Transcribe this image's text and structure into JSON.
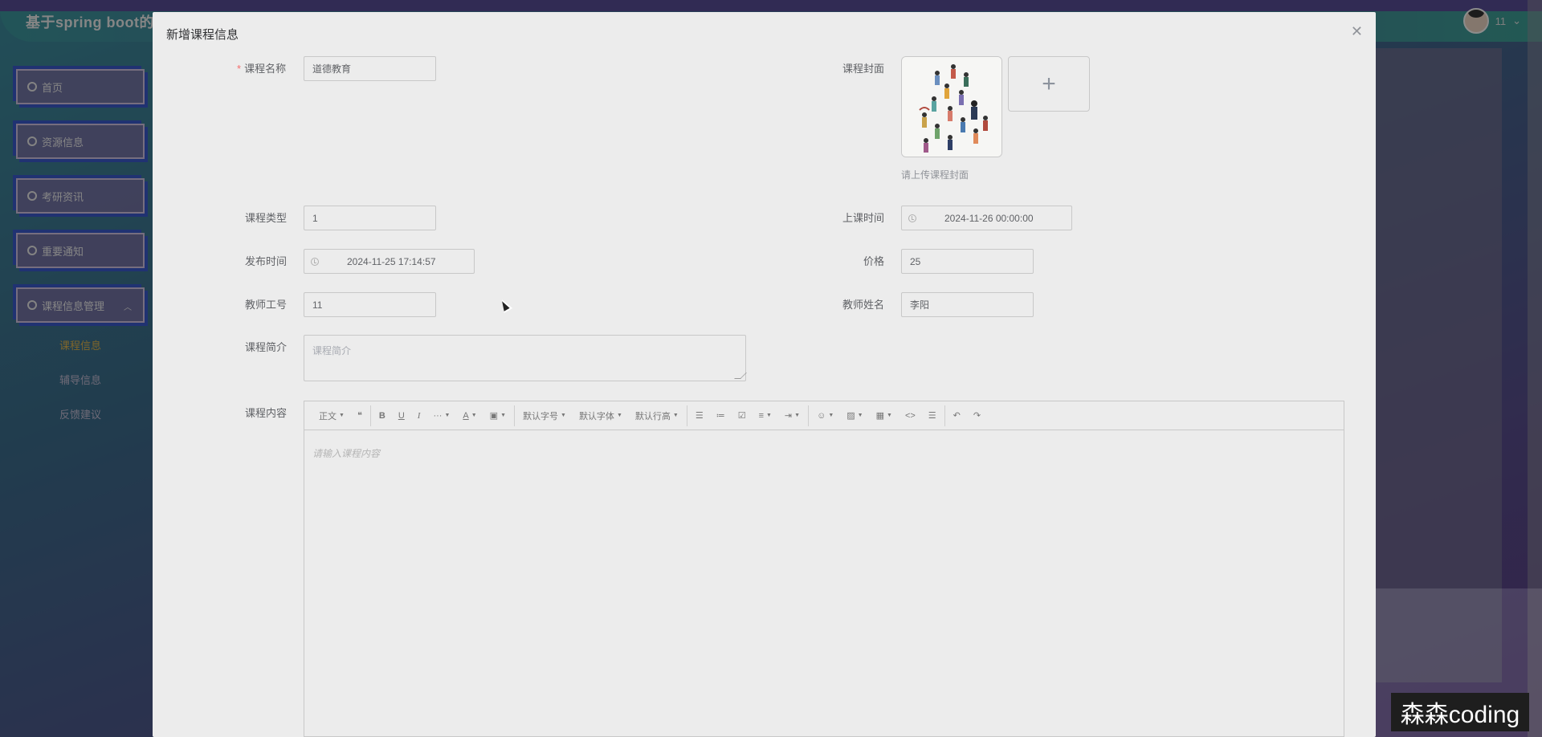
{
  "app": {
    "title": "基于spring boot的",
    "user_name": "11"
  },
  "sidebar": {
    "items": [
      {
        "label": "首页",
        "icon": "home-icon"
      },
      {
        "label": "资源信息",
        "icon": "grid-icon"
      },
      {
        "label": "考研资讯",
        "icon": "circle-icon"
      },
      {
        "label": "重要通知",
        "icon": "doc-icon"
      },
      {
        "label": "课程信息管理",
        "icon": "grid-icon"
      }
    ],
    "submenu": [
      {
        "label": "课程信息",
        "active": true
      },
      {
        "label": "辅导信息",
        "active": false
      },
      {
        "label": "反馈建议",
        "active": false
      }
    ]
  },
  "dialog": {
    "title": "新增课程信息",
    "close_icon": "close-icon",
    "fields": {
      "course_name": {
        "label": "课程名称",
        "value": "道德教育",
        "required": true
      },
      "cover": {
        "label": "课程封面",
        "hint": "请上传课程封面"
      },
      "course_type": {
        "label": "课程类型",
        "value": "1"
      },
      "class_time": {
        "label": "上课时间",
        "value": "2024-11-26 00:00:00"
      },
      "publish_time": {
        "label": "发布时间",
        "value": "2024-11-25 17:14:57"
      },
      "price": {
        "label": "价格",
        "value": "25"
      },
      "teacher_id": {
        "label": "教师工号",
        "value": "11"
      },
      "teacher_name": {
        "label": "教师姓名",
        "value": "李阳"
      },
      "intro": {
        "label": "课程简介",
        "placeholder": "课程简介"
      },
      "content": {
        "label": "课程内容",
        "placeholder": "请输入课程内容"
      }
    },
    "toolbar": {
      "paragraph": "正文",
      "font_size": "默认字号",
      "font_family": "默认字体",
      "line_height": "默认行高"
    }
  },
  "watermark": "森森coding",
  "colors": {
    "dialog_bg": "#ececec",
    "required": "#f56c6c",
    "active_submenu": "#e6b94e"
  }
}
